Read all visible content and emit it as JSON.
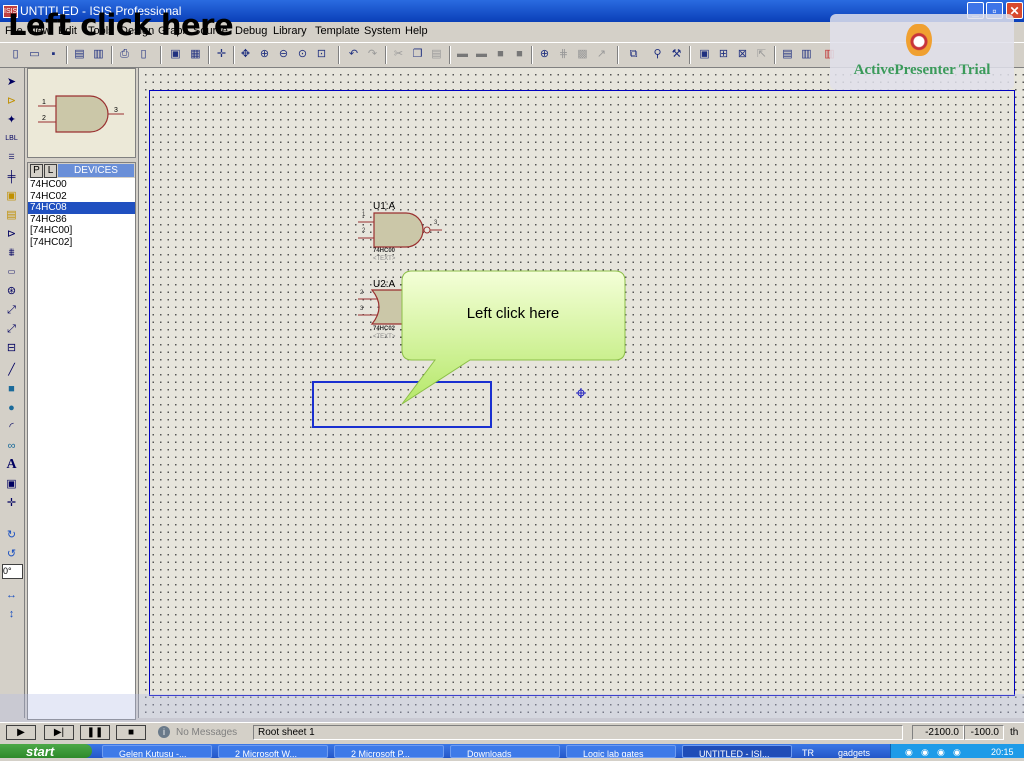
{
  "window": {
    "title": "UNTITLED - ISIS Professional",
    "app_icon": "ISIS",
    "controls": [
      "minimize",
      "maximize",
      "close"
    ]
  },
  "overlay_caption": "Left click here",
  "menu": [
    "File",
    "View",
    "Edit",
    "Tools",
    "Design",
    "Graph",
    "Source",
    "Debug",
    "Library",
    "Template",
    "System",
    "Help"
  ],
  "watermark": {
    "text": "ActivePresenter Trial"
  },
  "device_panel": {
    "pick_button": "P",
    "library_button": "L",
    "title": "DEVICES",
    "items": [
      "74HC00",
      "74HC02",
      "74HC08",
      "74HC86",
      "[74HC00]",
      "[74HC02]"
    ],
    "selected_index": 2
  },
  "preview": {
    "pin1": "1",
    "pin2": "2",
    "pin3": "3"
  },
  "toolbox": {
    "rotation_value": "0°"
  },
  "schematic": {
    "u1": {
      "ref": "U1:A",
      "part": "74HC00",
      "text": "<TEXT>",
      "pin1": "1",
      "pin2": "2",
      "pin3": "3"
    },
    "u2": {
      "ref": "U2:A",
      "part": "74HC02",
      "text": "<TEXT>",
      "pin2": "2",
      "pin3": "3"
    }
  },
  "callout": {
    "text": "Left click here"
  },
  "statusbar": {
    "messages": "No Messages",
    "sheet": "Root sheet 1",
    "x": "-2100.0",
    "y": "-100.0",
    "unit": "th"
  },
  "taskbar": {
    "start": "start",
    "tasks": [
      "Gelen Kutusu -...",
      "2 Microsoft W...",
      "2 Microsoft P...",
      "Downloads",
      "Logic lab gates",
      "UNTITLED - ISI..."
    ],
    "active_task_index": 5,
    "language": "TR",
    "tray_label": "gadgets",
    "clock": "20:15"
  }
}
